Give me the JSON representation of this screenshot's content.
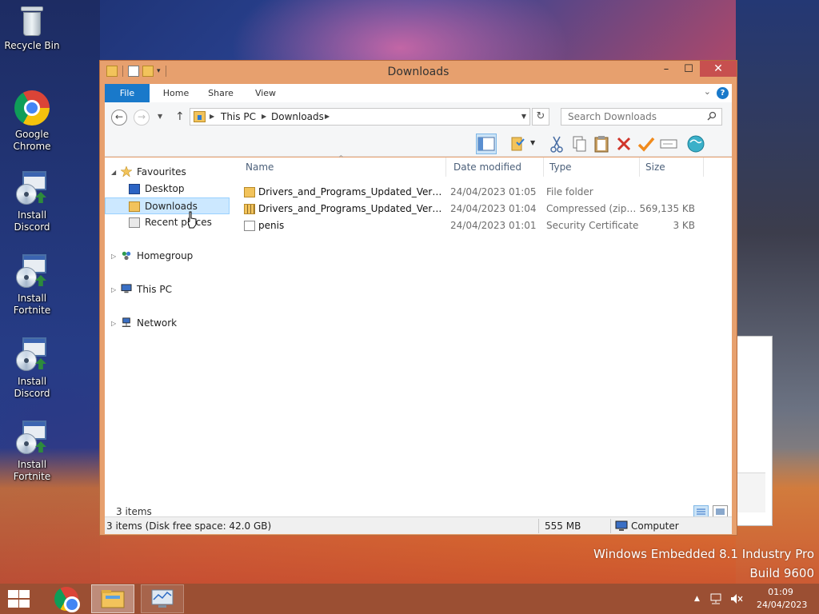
{
  "desktop": {
    "icons": [
      {
        "label": "Recycle Bin",
        "icon": "recycle-bin-icon"
      },
      {
        "label": "Google Chrome",
        "icon": "chrome-icon"
      },
      {
        "label": "Install Discord",
        "icon": "installer-icon"
      },
      {
        "label": "Install Fortnite",
        "icon": "installer-icon"
      },
      {
        "label": "Install Discord",
        "icon": "installer-icon"
      },
      {
        "label": "Install Fortnite",
        "icon": "installer-icon"
      }
    ],
    "watermark_line1": "Windows Embedded 8.1 Industry Pro",
    "watermark_line2": "Build 9600"
  },
  "window": {
    "title": "Downloads",
    "controls": {
      "minimize": "–",
      "maximize": "☐",
      "close": "✕"
    },
    "ribbon_tabs": [
      "File",
      "Home",
      "Share",
      "View"
    ],
    "help": "?",
    "address": {
      "crumbs": [
        "This PC",
        "Downloads"
      ],
      "search_placeholder": "Search Downloads"
    },
    "nav": {
      "favourites": "Favourites",
      "items": [
        "Desktop",
        "Downloads",
        "Recent places"
      ],
      "selected": "Downloads",
      "homegroup": "Homegroup",
      "this_pc": "This PC",
      "network": "Network"
    },
    "columns": {
      "name": "Name",
      "date": "Date modified",
      "type": "Type",
      "size": "Size"
    },
    "files": [
      {
        "name": "Drivers_and_Programs_Updated_Version_...",
        "date": "24/04/2023 01:05",
        "type": "File folder",
        "size": ""
      },
      {
        "name": "Drivers_and_Programs_Updated_Version_...",
        "date": "24/04/2023 01:04",
        "type": "Compressed (zipp...",
        "size": "569,135 KB"
      },
      {
        "name": "penis",
        "date": "24/04/2023 01:01",
        "type": "Security Certificate",
        "size": "3 KB"
      }
    ],
    "status": {
      "item_count": "3 items",
      "details": "3 items (Disk free space: 42.0 GB)",
      "size": "555 MB",
      "location": "Computer"
    }
  },
  "taskbar": {
    "time": "01:09",
    "date": "24/04/2023"
  },
  "colors": {
    "window_frame": "#e7a06e",
    "accent_blue": "#1979ca",
    "close_red": "#c7504f",
    "taskbar": "#96462a"
  }
}
